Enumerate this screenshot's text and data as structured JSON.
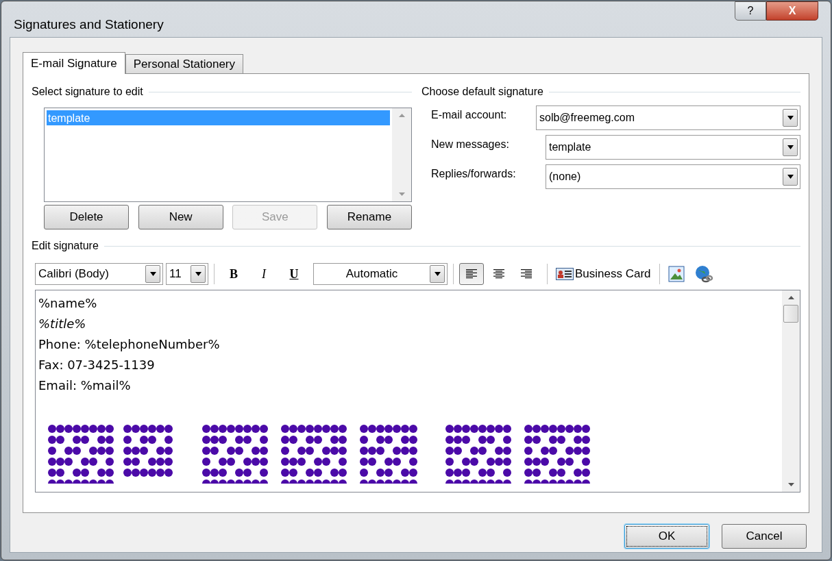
{
  "window": {
    "title": "Signatures and Stationery",
    "help_button": "?",
    "close_button": "X"
  },
  "tabs": [
    {
      "label": "E-mail Signature",
      "selected": true
    },
    {
      "label": "Personal Stationery",
      "selected": false
    }
  ],
  "select_signature": {
    "heading": "Select signature to edit",
    "items": [
      {
        "label": "template",
        "selected": true
      }
    ],
    "buttons": [
      {
        "label": "Delete",
        "disabled": false
      },
      {
        "label": "New",
        "disabled": false
      },
      {
        "label": "Save",
        "disabled": true
      },
      {
        "label": "Rename",
        "disabled": false
      }
    ]
  },
  "default_signature": {
    "heading": "Choose default signature",
    "fields": [
      {
        "label": "E-mail account:",
        "value": "solb@freemeg.com"
      },
      {
        "label": "New messages:",
        "value": "template"
      },
      {
        "label": "Replies/forwards:",
        "value": "(none)"
      }
    ]
  },
  "edit_signature": {
    "heading": "Edit signature",
    "toolbar": {
      "font": "Calibri (Body)",
      "size": "11",
      "format_buttons": [
        {
          "kind": "bold",
          "label": "B"
        },
        {
          "kind": "italic",
          "label": "I"
        },
        {
          "kind": "underline",
          "label": "U"
        }
      ],
      "font_color": "Automatic",
      "alignments": [
        {
          "kind": "left",
          "selected": true
        },
        {
          "kind": "center",
          "selected": false
        },
        {
          "kind": "right",
          "selected": false
        }
      ],
      "business_card": "Business Card"
    },
    "lines": [
      {
        "text": "%name%",
        "italic": false
      },
      {
        "text": "%title%",
        "italic": true
      },
      {
        "text": "Phone: %telephoneNumber%",
        "italic": false
      },
      {
        "text": "Fax: 07-3425-1139",
        "italic": false
      },
      {
        "text": "Email: %mail%",
        "italic": false
      }
    ]
  },
  "footer_buttons": [
    {
      "label": "OK",
      "default": true
    },
    {
      "label": "Cancel",
      "default": false
    }
  ]
}
